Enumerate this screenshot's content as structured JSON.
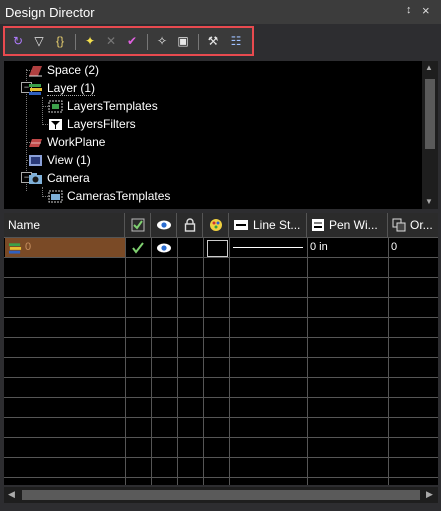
{
  "window": {
    "title": "Design Director",
    "pin_glyph": "↕",
    "close_glyph": "×"
  },
  "toolbar": {
    "buttons": [
      {
        "name": "refresh-icon",
        "glyph": "↻",
        "color": "#b07cff"
      },
      {
        "name": "filter-icon",
        "glyph": "▽",
        "color": "#e8e8e8"
      },
      {
        "name": "brackets-icon",
        "glyph": "{}",
        "color": "#e8d070"
      },
      {
        "name": "new-item-icon",
        "glyph": "✦",
        "color": "#f4e04d"
      },
      {
        "name": "delete-icon",
        "glyph": "✕",
        "color": "#777777"
      },
      {
        "name": "check-icon",
        "glyph": "✔",
        "color": "#e060e0"
      },
      {
        "name": "add-star-icon",
        "glyph": "✧",
        "color": "#e8e8e8"
      },
      {
        "name": "properties-icon",
        "glyph": "▣",
        "color": "#e8e8e8"
      },
      {
        "name": "tool-icon",
        "glyph": "⚒",
        "color": "#e8e8e8"
      },
      {
        "name": "options-icon",
        "glyph": "☷",
        "color": "#9fc0ff"
      }
    ]
  },
  "tree": {
    "nodes": [
      {
        "label": "Space (2)",
        "icon": "space-icon"
      },
      {
        "label": "Layer (1)",
        "icon": "layer-icon",
        "expander": "−"
      },
      {
        "label": "LayersTemplates",
        "icon": "layers-templates-icon"
      },
      {
        "label": "LayersFilters",
        "icon": "layers-filters-icon"
      },
      {
        "label": "WorkPlane",
        "icon": "workplane-icon"
      },
      {
        "label": "View (1)",
        "icon": "view-icon"
      },
      {
        "label": "Camera",
        "icon": "camera-icon",
        "expander": "−"
      },
      {
        "label": "CamerasTemplates",
        "icon": "cameras-templates-icon"
      }
    ]
  },
  "grid": {
    "columns": [
      {
        "label": "Name"
      },
      {
        "label": "",
        "icon": "visible-check-icon"
      },
      {
        "label": "",
        "icon": "eye-icon"
      },
      {
        "label": "",
        "icon": "lock-icon"
      },
      {
        "label": "",
        "icon": "color-palette-icon"
      },
      {
        "label": "Line St...",
        "icon": "line-style-icon"
      },
      {
        "label": "Pen Wi...",
        "icon": "pen-width-icon"
      },
      {
        "label": "Or...",
        "icon": "order-icon"
      }
    ],
    "row": {
      "name": "0",
      "line_width": "0 in",
      "order": "0"
    },
    "colors": {
      "selected_row": "#7a4a26",
      "border": "#555555"
    }
  }
}
